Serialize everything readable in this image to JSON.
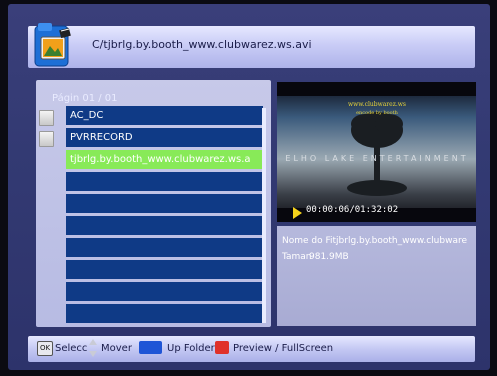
{
  "header": {
    "path": "C/tjbrlg.by.booth_www.clubwarez.ws.avi",
    "icon": "folder-film-icon"
  },
  "browser": {
    "page_label": "Págin 01 / 01",
    "items": [
      {
        "label": "AC_DC",
        "type": "folder"
      },
      {
        "label": "PVRRECORD",
        "type": "folder"
      },
      {
        "label": "tjbrlg.by.booth_www.clubwarez.ws.a",
        "type": "file",
        "selected": true
      },
      {
        "label": ""
      },
      {
        "label": ""
      },
      {
        "label": ""
      },
      {
        "label": ""
      },
      {
        "label": ""
      },
      {
        "label": ""
      },
      {
        "label": ""
      }
    ],
    "colors": {
      "row": "#0f3a86",
      "selected": "#88ea58"
    }
  },
  "preview": {
    "overlay_top": "www.clubwarez.ws",
    "overlay_sub": "encode by booth",
    "overlay_center": "ELHO LAKE ENTERTAINMENT",
    "time": "00:00:06/01:32:02",
    "play_icon": "play-icon"
  },
  "info": {
    "name_line": "Nome do Fitjbrlg.by.booth_www.clubware",
    "size_line_label": "Taman",
    "size_line_value": "981.9MB"
  },
  "footer": {
    "ok_key": "OK",
    "select_label": "Selecc",
    "move_label": "Mover",
    "up_label": "Up Folder",
    "preview_label": "Preview / FullScreen",
    "colors": {
      "blue": "#1f55d6",
      "red": "#e0312a"
    }
  }
}
